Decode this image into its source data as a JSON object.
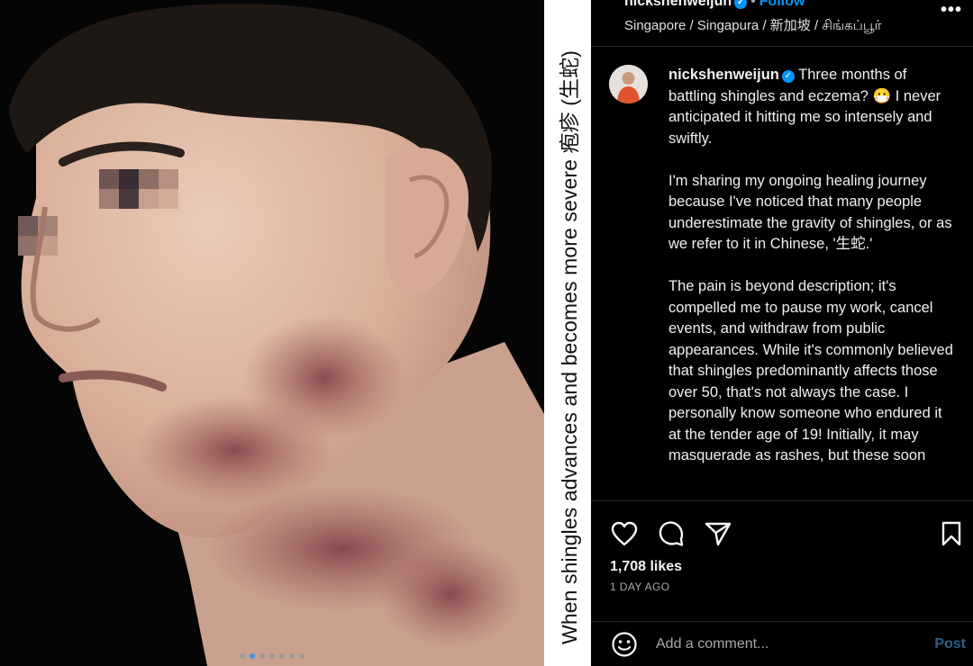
{
  "photo": {
    "carousel_total": 7,
    "carousel_active_index": 1
  },
  "overlay_caption": "When shingles advances and becomes more severe 疱疹 (生蛇)",
  "post": {
    "username": "nickshenweijun",
    "follow_label": "Follow",
    "separator": "•",
    "location": "Singapore / Singapura / 新加坡 / சிங்கப்பூர்",
    "more_label": "•••",
    "caption": {
      "username": "nickshenweijun",
      "paragraphs": [
        "Three months of battling shingles and eczema? 😷 I never anticipated it hitting me so intensely and swiftly.",
        "I'm sharing my ongoing healing journey because I've noticed that many people underestimate the gravity of shingles, or as we refer to it in Chinese, '生蛇.'",
        "The pain is beyond description; it's compelled me to pause my work, cancel events, and withdraw from public appearances. While it's commonly believed that shingles predominantly affects those over 50, that's not always the case. I personally know someone who endured it at the tender age of 19! Initially, it may masquerade as rashes, but these soon"
      ]
    },
    "likes": "1,708 likes",
    "time_ago": "1 DAY AGO",
    "comment": {
      "placeholder": "Add a comment...",
      "post_label": "Post"
    }
  },
  "icons": {
    "like": "heart-icon",
    "comment": "comment-bubble-icon",
    "share": "paper-plane-icon",
    "save": "bookmark-icon",
    "emoji": "smiley-face-icon",
    "verified": "verified-badge-icon"
  },
  "colors": {
    "accent": "#0095f6",
    "panel_bg": "#000000",
    "caption_strip_bg": "#ffffff",
    "post_button_disabled": "#2d5f86"
  }
}
